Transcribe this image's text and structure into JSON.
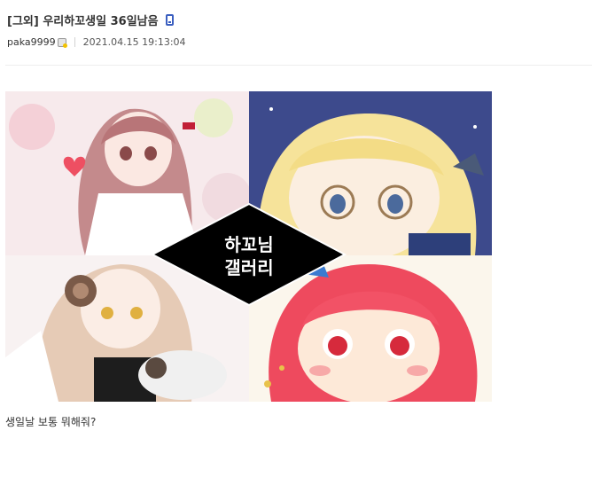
{
  "post": {
    "title": "[그외] 우리하꼬생일 36일남음",
    "writer": "paka9999",
    "date": "2021.04.15 19:13:04",
    "image_caption_line1": "하꼬님",
    "image_caption_line2": "갤러리",
    "body": "생일날 보통 뭐해줘?"
  },
  "icons": {
    "mobile": "mobile-phone-icon",
    "member": "fixed-member-icon"
  },
  "colors": {
    "mobile_icon": "#3b5fc0",
    "caption_bg": "#000000",
    "caption_text": "#ffffff"
  }
}
